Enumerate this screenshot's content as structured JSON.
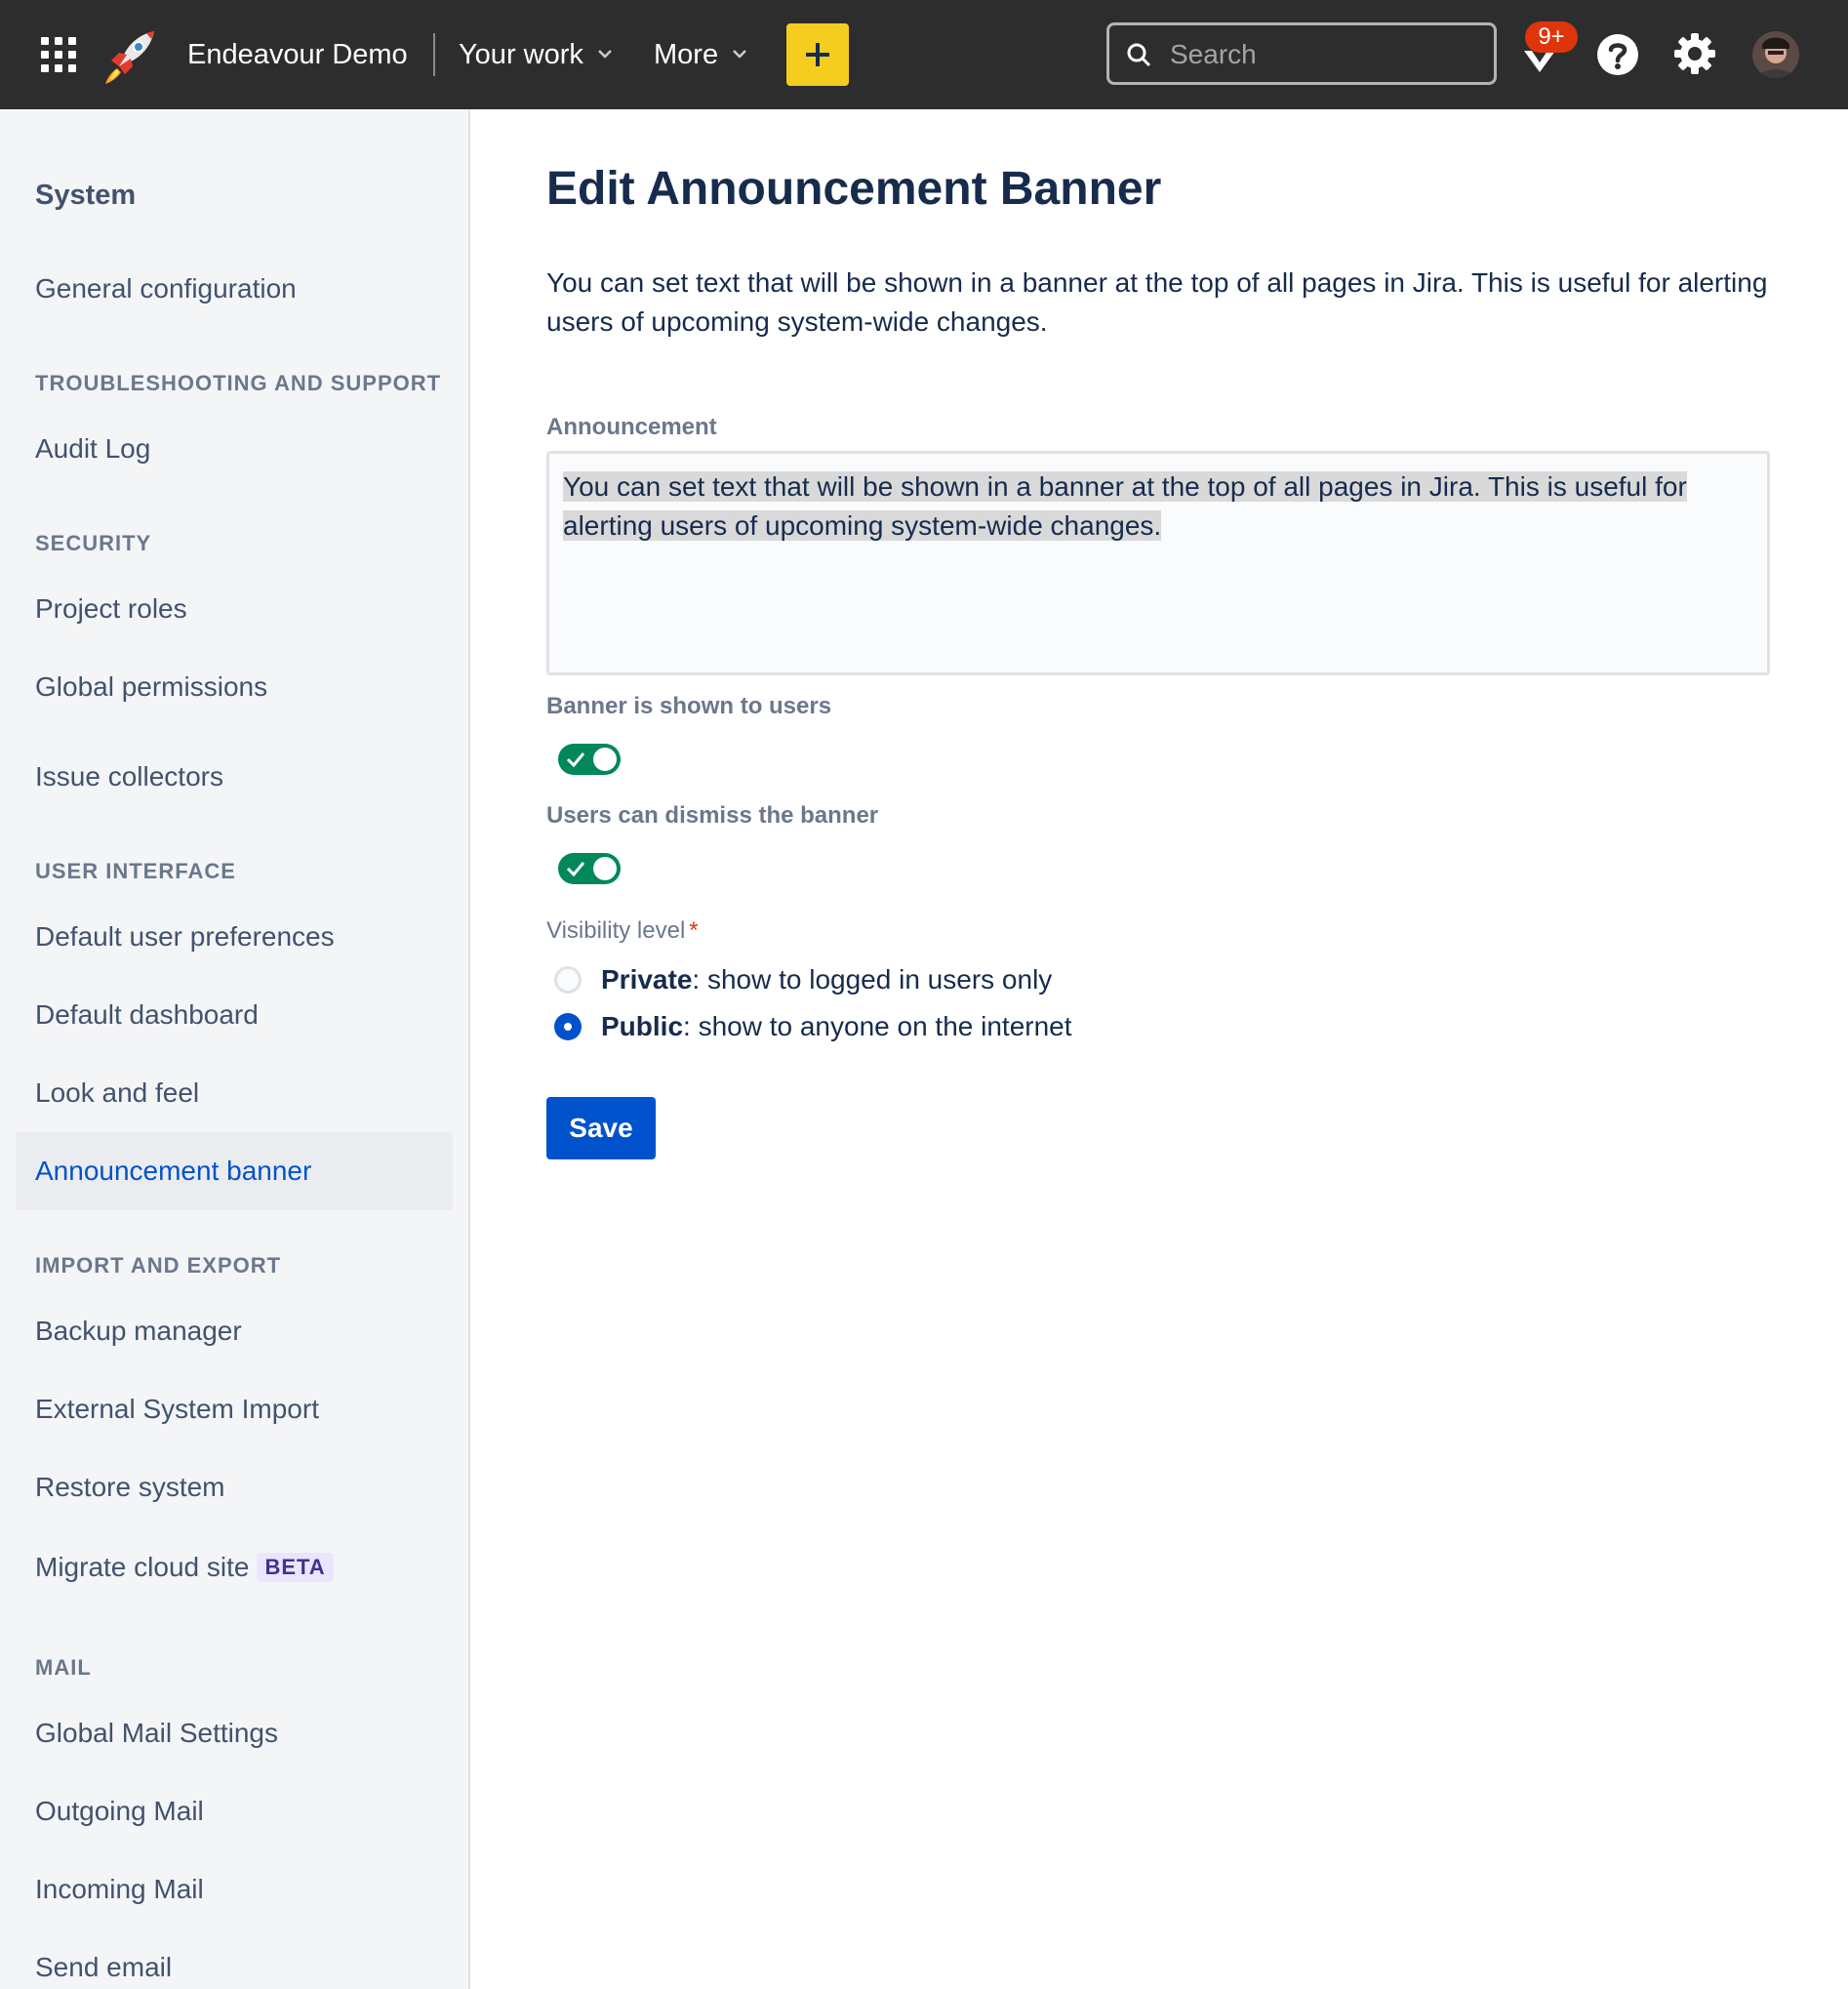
{
  "topnav": {
    "site_name": "Endeavour Demo",
    "your_work": "Your work",
    "more": "More",
    "create_icon": "plus-icon",
    "search_placeholder": "Search",
    "notification_badge": "9+",
    "colors": {
      "bar": "#2d2d2d",
      "create": "#f5cd1f",
      "badge": "#de350b"
    }
  },
  "sidebar": {
    "title": "System",
    "general_configuration": "General configuration",
    "troubleshooting_heading": "TROUBLESHOOTING AND SUPPORT",
    "audit_log": "Audit Log",
    "security_heading": "SECURITY",
    "project_roles": "Project roles",
    "global_permissions": "Global permissions",
    "issue_collectors": "Issue collectors",
    "user_interface_heading": "USER INTERFACE",
    "default_user_preferences": "Default user preferences",
    "default_dashboard": "Default dashboard",
    "look_and_feel": "Look and feel",
    "announcement_banner": "Announcement banner",
    "import_export_heading": "IMPORT AND EXPORT",
    "backup_manager": "Backup manager",
    "external_system_import": "External System Import",
    "restore_system": "Restore system",
    "migrate_cloud_site": "Migrate cloud site",
    "beta_badge": "BETA",
    "mail_heading": "MAIL",
    "global_mail_settings": "Global Mail Settings",
    "outgoing_mail": "Outgoing Mail",
    "incoming_mail": "Incoming Mail",
    "send_email": "Send email",
    "active_item": "Announcement banner"
  },
  "main": {
    "title": "Edit Announcement Banner",
    "intro": "You can set text that will be shown in a banner at the top of all pages in Jira. This is useful for alerting users of upcoming system-wide changes.",
    "announcement_label": "Announcement",
    "announcement_value": "You can set text that will be shown in a banner at the top of all pages in Jira. This is useful for alerting users of upcoming system-wide changes.",
    "banner_shown_label": "Banner is shown to users",
    "banner_shown_on": true,
    "dismiss_label": "Users can dismiss the banner",
    "dismiss_on": true,
    "visibility_label": "Visibility level",
    "required_marker": "*",
    "private_strong": "Private",
    "private_rest": ": show to logged in users only",
    "public_strong": "Public",
    "public_rest": ": show to anyone on the internet",
    "selected_visibility": "Public",
    "save_label": "Save",
    "colors": {
      "toggle_on": "#00875a",
      "primary": "#0052cc"
    }
  }
}
